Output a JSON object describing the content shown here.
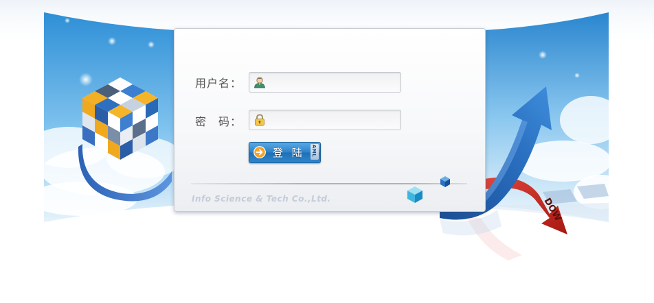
{
  "login_form": {
    "username_label": "用户名：",
    "password_label": "密　码：",
    "username_value": "",
    "password_value": "",
    "login_button_label": "登 陆",
    "login_button_tag": "AML"
  },
  "footer": {
    "company": "Info Science & Tech Co.,Ltd."
  },
  "decoration": {
    "ribbon_text": "DOW"
  },
  "colors": {
    "sky": "#3e9bd9",
    "button_blue": "#2a80c8",
    "label_gray": "#555555",
    "company_text": "#c3ccd8",
    "arrow_blue": "#1d5ea8",
    "arrow_red": "#c8251e"
  },
  "icons": [
    "user-icon",
    "lock-icon",
    "arrow-right-circle-icon",
    "cube-icon",
    "trend-arrow-icon"
  ]
}
